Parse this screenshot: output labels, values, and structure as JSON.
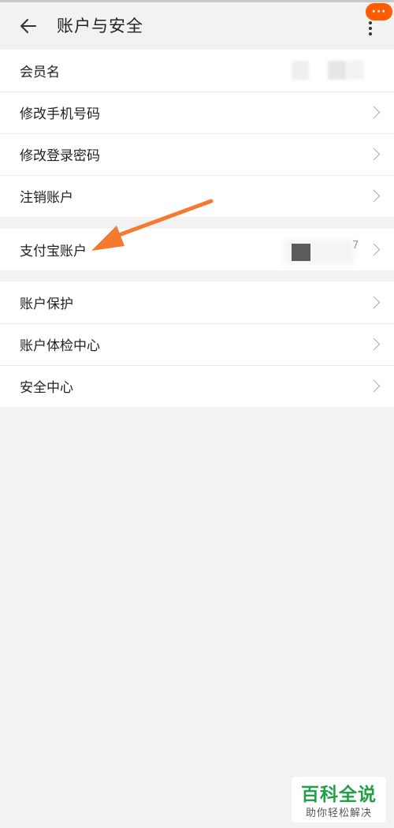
{
  "header": {
    "title": "账户与安全",
    "back_icon": "back-arrow-icon",
    "more_icon": "more-vertical-icon",
    "badge_text": "···",
    "badge_color": "#ff5b00"
  },
  "group1": [
    {
      "label": "会员名",
      "value": "",
      "has_chevron": false
    },
    {
      "label": "修改手机号码",
      "has_chevron": true
    },
    {
      "label": "修改登录密码",
      "has_chevron": true
    },
    {
      "label": "注销账户",
      "has_chevron": true
    }
  ],
  "group2": [
    {
      "label": "支付宝账户",
      "trail": "7",
      "has_chevron": true
    }
  ],
  "group3": [
    {
      "label": "账户保护",
      "has_chevron": true
    },
    {
      "label": "账户体检中心",
      "has_chevron": true
    },
    {
      "label": "安全中心",
      "has_chevron": true
    }
  ],
  "annotation": {
    "arrow_color": "#f47a30"
  },
  "watermark": {
    "title": "百科全说",
    "subtitle": "助你轻松解决",
    "color": "#22a046"
  }
}
